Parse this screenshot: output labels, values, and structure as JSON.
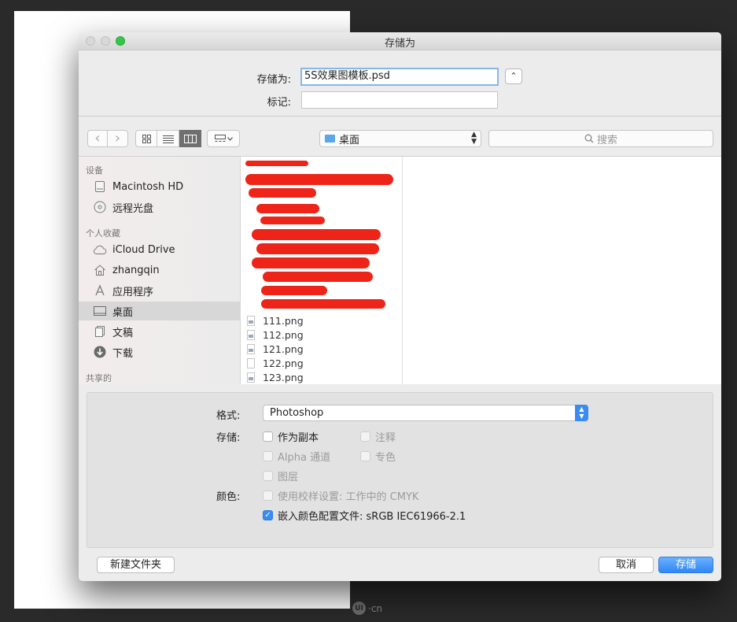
{
  "dialog": {
    "title": "存储为"
  },
  "save_form": {
    "save_as_label": "存储为:",
    "filename": "5S效果图模板.psd",
    "tags_label": "标记:",
    "tags_value": "",
    "collapse_glyph": "⌃"
  },
  "toolbar": {
    "back_glyph": "‹",
    "forward_glyph": "›",
    "location": "桌面",
    "search_placeholder": "搜索"
  },
  "sidebar": {
    "devices_header": "设备",
    "devices": [
      {
        "label": "Macintosh HD",
        "icon": "hard-drive-icon"
      },
      {
        "label": "远程光盘",
        "icon": "disc-icon"
      }
    ],
    "favorites_header": "个人收藏",
    "favorites": [
      {
        "label": "iCloud Drive",
        "icon": "cloud-icon"
      },
      {
        "label": "zhangqin",
        "icon": "home-icon"
      },
      {
        "label": "应用程序",
        "icon": "applications-icon"
      },
      {
        "label": "桌面",
        "icon": "desktop-icon",
        "selected": true
      },
      {
        "label": "文稿",
        "icon": "documents-icon"
      },
      {
        "label": "下载",
        "icon": "download-icon"
      }
    ],
    "shared_header": "共享的"
  },
  "files": [
    {
      "name": "111.png",
      "icon": "image-file-icon"
    },
    {
      "name": "112.png",
      "icon": "image-file-icon"
    },
    {
      "name": "121.png",
      "icon": "image-file-icon"
    },
    {
      "name": "122.png",
      "icon": "image-file-icon"
    },
    {
      "name": "123.png",
      "icon": "image-file-icon"
    }
  ],
  "options": {
    "format_label": "格式:",
    "format_value": "Photoshop",
    "save_label": "存储:",
    "color_label": "颜色:",
    "as_copy": {
      "label": "作为副本",
      "checked": false,
      "disabled": false
    },
    "notes": {
      "label": "注释",
      "checked": false,
      "disabled": true
    },
    "alpha": {
      "label": "Alpha 通道",
      "checked": false,
      "disabled": true
    },
    "spot": {
      "label": "专色",
      "checked": false,
      "disabled": true
    },
    "layers": {
      "label": "图层",
      "checked": false,
      "disabled": true
    },
    "proof": {
      "label": "使用校样设置: 工作中的 CMYK",
      "checked": false,
      "disabled": true
    },
    "embed_profile": {
      "label": "嵌入颜色配置文件: sRGB IEC61966-2.1",
      "checked": true,
      "disabled": false
    }
  },
  "footer": {
    "new_folder": "新建文件夹",
    "cancel": "取消",
    "save": "存储"
  },
  "watermark": {
    "logo": "UI",
    "text": "·cn"
  },
  "colors": {
    "accent": "#3b8cf0",
    "redaction": "#ee2418"
  }
}
